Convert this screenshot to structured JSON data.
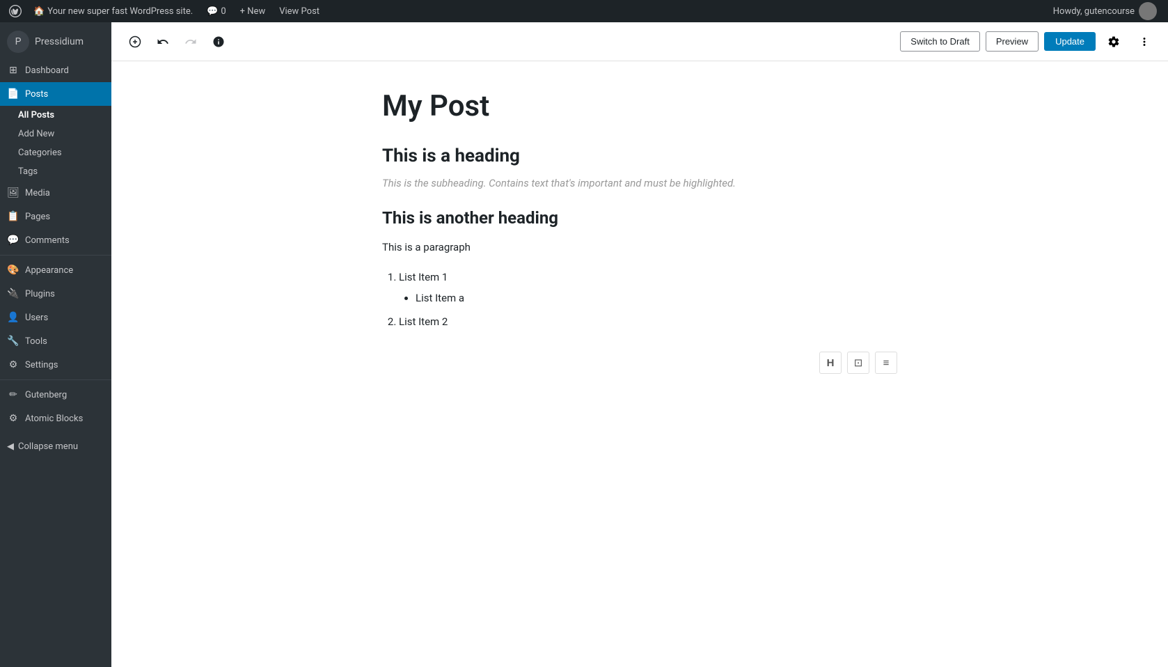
{
  "admin_bar": {
    "logo_symbol": "W",
    "site_name": "Your new super fast WordPress site.",
    "comments_icon": "💬",
    "comments_count": "0",
    "new_label": "+ New",
    "view_post_label": "View Post",
    "howdy": "Howdy, gutencourse"
  },
  "sidebar": {
    "brand_label": "Pressidium",
    "items": [
      {
        "id": "dashboard",
        "label": "Dashboard",
        "icon": "⊞"
      },
      {
        "id": "posts",
        "label": "Posts",
        "icon": "📄",
        "active": true
      },
      {
        "id": "media",
        "label": "Media",
        "icon": "🖼"
      },
      {
        "id": "pages",
        "label": "Pages",
        "icon": "📋"
      },
      {
        "id": "comments",
        "label": "Comments",
        "icon": "💬"
      },
      {
        "id": "appearance",
        "label": "Appearance",
        "icon": "🎨"
      },
      {
        "id": "plugins",
        "label": "Plugins",
        "icon": "🔌"
      },
      {
        "id": "users",
        "label": "Users",
        "icon": "👤"
      },
      {
        "id": "tools",
        "label": "Tools",
        "icon": "🔧"
      },
      {
        "id": "settings",
        "label": "Settings",
        "icon": "⚙"
      },
      {
        "id": "gutenberg",
        "label": "Gutenberg",
        "icon": "✏"
      },
      {
        "id": "atomic-blocks",
        "label": "Atomic Blocks",
        "icon": "⚙"
      }
    ],
    "posts_submenu": [
      {
        "id": "all-posts",
        "label": "All Posts",
        "active": true
      },
      {
        "id": "add-new",
        "label": "Add New"
      },
      {
        "id": "categories",
        "label": "Categories"
      },
      {
        "id": "tags",
        "label": "Tags"
      }
    ],
    "collapse_label": "Collapse menu"
  },
  "editor": {
    "toolbar": {
      "add_block_title": "Add block",
      "undo_title": "Undo",
      "redo_title": "Redo",
      "info_title": "Information",
      "switch_draft_label": "Switch to Draft",
      "preview_label": "Preview",
      "update_label": "Update",
      "settings_title": "Settings",
      "more_title": "More tools & options"
    },
    "post_title": "My Post",
    "blocks": [
      {
        "type": "heading",
        "text": "This is a heading"
      },
      {
        "type": "subheading",
        "text": "This is the subheading. Contains text that's important and must be highlighted."
      },
      {
        "type": "heading",
        "text": "This is another heading"
      },
      {
        "type": "paragraph",
        "text": "This is a paragraph"
      }
    ],
    "list": {
      "items": [
        {
          "label": "List Item 1",
          "sub": [
            "List Item a"
          ]
        },
        {
          "label": "List Item 2"
        }
      ]
    },
    "inserter_buttons": [
      {
        "id": "heading-btn",
        "icon": "H",
        "title": "Heading"
      },
      {
        "id": "image-btn",
        "icon": "⊡",
        "title": "Image"
      },
      {
        "id": "list-btn",
        "icon": "≡",
        "title": "List"
      }
    ]
  }
}
